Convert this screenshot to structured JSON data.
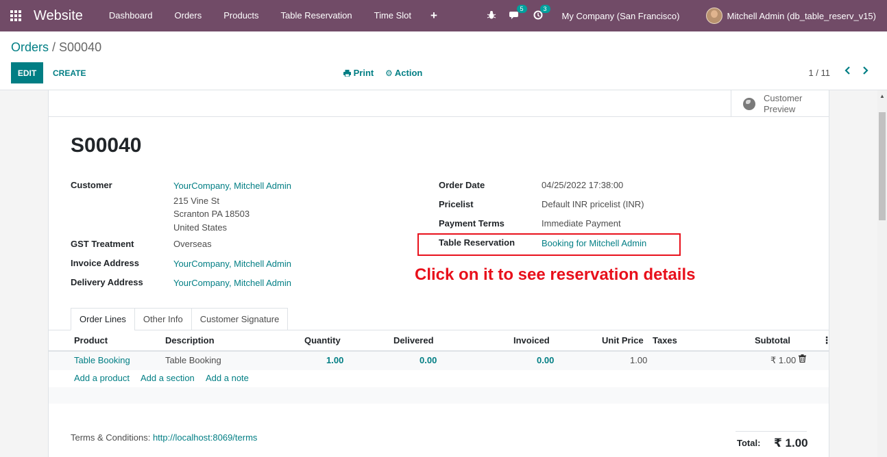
{
  "navbar": {
    "brand": "Website",
    "menu": [
      "Dashboard",
      "Orders",
      "Products",
      "Table Reservation",
      "Time Slot"
    ],
    "plus": "+",
    "messages_badge": "5",
    "activity_badge": "3",
    "company": "My Company (San Francisco)",
    "user": "Mitchell Admin (db_table_reserv_v15)"
  },
  "control_panel": {
    "breadcrumb_parent": "Orders",
    "breadcrumb_sep": " / ",
    "breadcrumb_current": "S00040",
    "edit_label": "EDIT",
    "create_label": "CREATE",
    "print_label": "Print",
    "action_label": "Action",
    "pager": "1 / 11"
  },
  "smart_button": {
    "label": "Customer Preview"
  },
  "order": {
    "name": "S00040",
    "customer_label": "Customer",
    "customer": "YourCompany, Mitchell Admin",
    "address_line1": "215 Vine St",
    "address_line2": "Scranton PA 18503",
    "address_line3": "United States",
    "gst_label": "GST Treatment",
    "gst": "Overseas",
    "invoice_label": "Invoice Address",
    "invoice": "YourCompany, Mitchell Admin",
    "delivery_label": "Delivery Address",
    "delivery": "YourCompany, Mitchell Admin",
    "date_label": "Order Date",
    "date": "04/25/2022 17:38:00",
    "pricelist_label": "Pricelist",
    "pricelist": "Default INR pricelist (INR)",
    "terms_label": "Payment Terms",
    "terms": "Immediate Payment",
    "reservation_label": "Table Reservation",
    "reservation": "Booking for Mitchell Admin"
  },
  "annotation": "Click on it to see reservation details",
  "tabs": [
    "Order Lines",
    "Other Info",
    "Customer Signature"
  ],
  "table": {
    "headers": [
      "Product",
      "Description",
      "Quantity",
      "Delivered",
      "Invoiced",
      "Unit Price",
      "Taxes",
      "Subtotal"
    ],
    "rows": [
      {
        "product": "Table Booking",
        "description": "Table Booking",
        "quantity": "1.00",
        "delivered": "0.00",
        "invoiced": "0.00",
        "unit_price": "1.00",
        "taxes": "",
        "subtotal": "₹ 1.00"
      }
    ],
    "add_product": "Add a product",
    "add_section": "Add a section",
    "add_note": "Add a note"
  },
  "footer": {
    "terms_label": "Terms & Conditions:",
    "terms_link": "http://localhost:8069/terms",
    "total_label": "Total:",
    "total_value": "₹ 1.00"
  }
}
